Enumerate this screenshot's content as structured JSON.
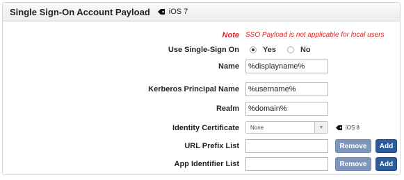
{
  "header": {
    "title": "Single Sign-On Account Payload",
    "os_label": "iOS 7"
  },
  "form": {
    "note_label": "Note",
    "note_text": "SSO Payload is not applicable for local users",
    "use_sso_label": "Use Single-Sign On",
    "use_sso_options": [
      "Yes",
      "No"
    ],
    "use_sso_selected": "Yes",
    "name_label": "Name",
    "name_value": "%displayname%",
    "kerberos_label": "Kerberos Principal Name",
    "kerberos_value": "%username%",
    "realm_label": "Realm",
    "realm_value": "%domain%",
    "identity_cert_label": "Identity Certificate",
    "identity_cert_value": "None",
    "identity_cert_os": "iOS 8",
    "url_prefix_label": "URL Prefix List",
    "url_prefix_value": "",
    "app_identifier_label": "App Identifier List",
    "app_identifier_value": "",
    "remove_label": "Remove",
    "add_label": "Add"
  },
  "icons": {
    "os_tag": "tag-icon",
    "select_arrow": "chevron-down-icon"
  },
  "colors": {
    "note": "#e0201f",
    "remove_button": "#7e97ba",
    "add_button": "#2d5b9a"
  }
}
